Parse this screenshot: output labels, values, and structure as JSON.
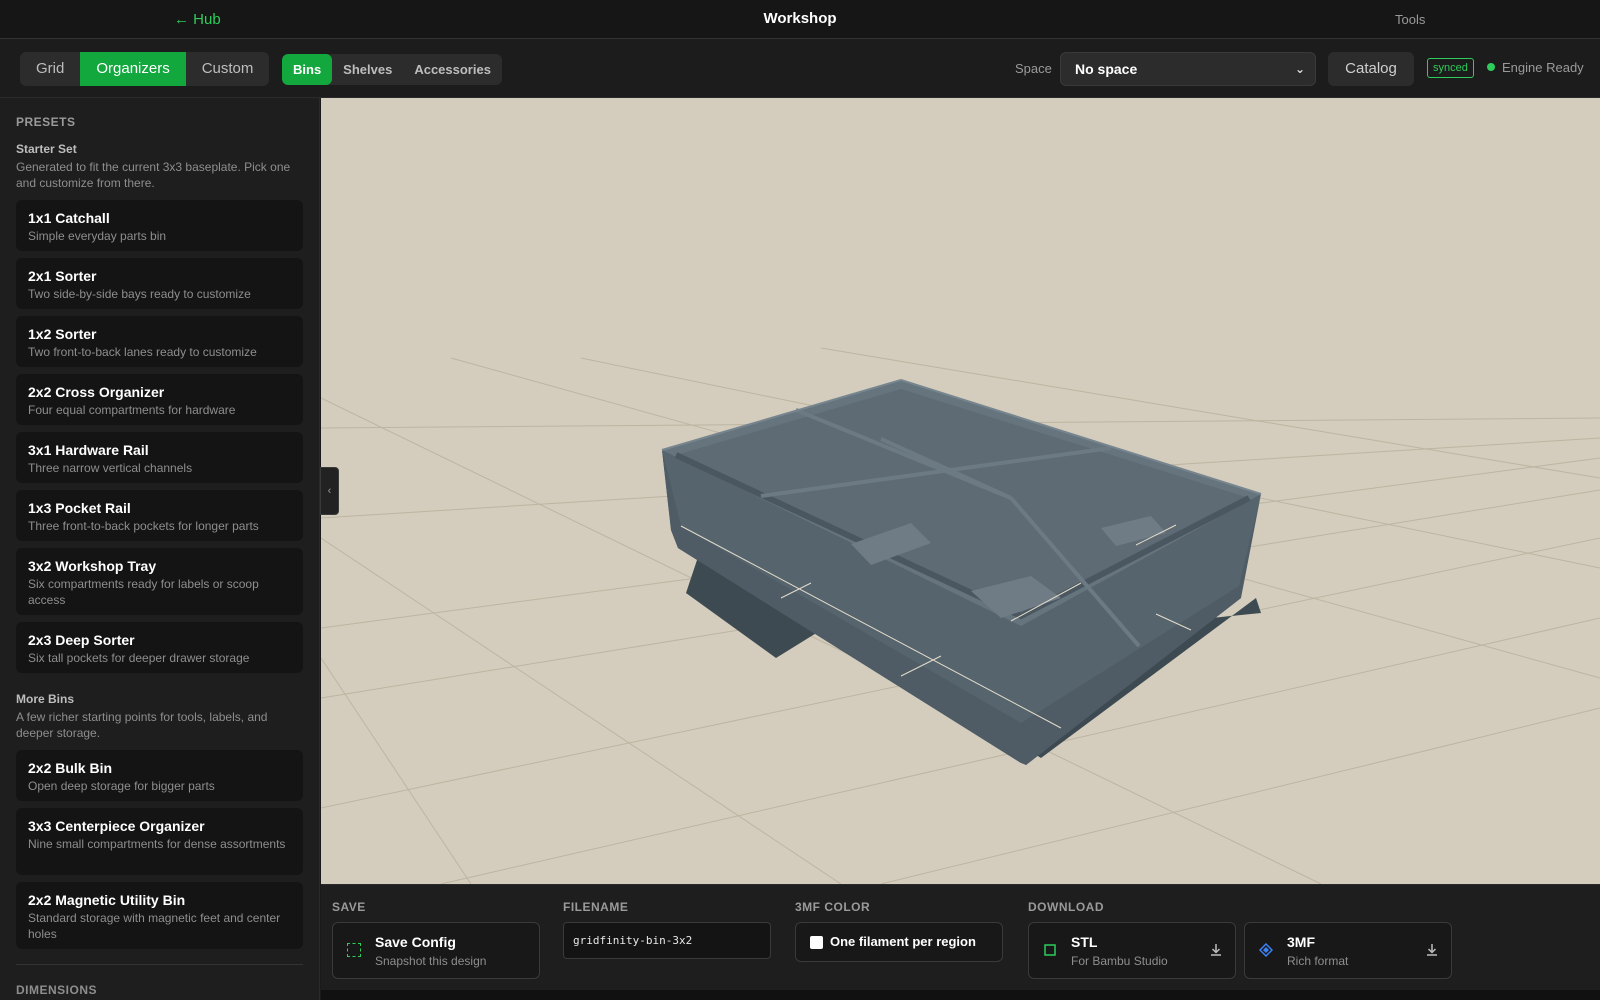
{
  "topbar": {
    "hub": "← Hub",
    "title": "Workshop",
    "tools": "Tools"
  },
  "toolbar": {
    "modes": [
      "Grid",
      "Organizers",
      "Custom"
    ],
    "active_mode": "Organizers",
    "subtabs": [
      "Bins",
      "Shelves",
      "Accessories"
    ],
    "active_subtab": "Bins",
    "space_label": "Space",
    "space_value": "No space",
    "catalog": "Catalog",
    "synced": "synced",
    "engine": "Engine Ready"
  },
  "sidebar": {
    "heading": "PRESETS",
    "groups": [
      {
        "title": "Starter Set",
        "desc": "Generated to fit the current 3x3 baseplate. Pick one and customize from there.",
        "items": [
          {
            "name": "1x1 Catchall",
            "desc": "Simple everyday parts bin"
          },
          {
            "name": "2x1 Sorter",
            "desc": "Two side-by-side bays ready to customize"
          },
          {
            "name": "1x2 Sorter",
            "desc": "Two front-to-back lanes ready to customize"
          },
          {
            "name": "2x2 Cross Organizer",
            "desc": "Four equal compartments for hardware"
          },
          {
            "name": "3x1 Hardware Rail",
            "desc": "Three narrow vertical channels"
          },
          {
            "name": "1x3 Pocket Rail",
            "desc": "Three front-to-back pockets for longer parts"
          },
          {
            "name": "3x2 Workshop Tray",
            "desc": "Six compartments ready for labels or scoop access"
          },
          {
            "name": "2x3 Deep Sorter",
            "desc": "Six tall pockets for deeper drawer storage"
          }
        ]
      },
      {
        "title": "More Bins",
        "desc": "A few richer starting points for tools, labels, and deeper storage.",
        "items": [
          {
            "name": "2x2 Bulk Bin",
            "desc": "Open deep storage for bigger parts"
          },
          {
            "name": "3x3 Centerpiece Organizer",
            "desc": "Nine small compartments for dense assortments"
          },
          {
            "name": "2x2 Magnetic Utility Bin",
            "desc": "Standard storage with magnetic feet and center holes"
          }
        ]
      }
    ],
    "next_section": "DIMENSIONS"
  },
  "bottom": {
    "save_label": "SAVE",
    "save_title": "Save Config",
    "save_sub": "Snapshot this design",
    "filename_label": "FILENAME",
    "filename_value": "gridfinity-bin-3x2",
    "color_label": "3MF COLOR",
    "color_option": "One filament per region",
    "color_checked": false,
    "download_label": "DOWNLOAD",
    "stl_title": "STL",
    "stl_sub": "For Bambu Studio",
    "mf_title": "3MF",
    "mf_sub": "Rich format"
  },
  "colors": {
    "accent": "#12a83e",
    "viewport_bg": "#d4cdbd",
    "model": "#56646e",
    "stl_icon": "#2ecc5a",
    "mf_icon": "#3b82f6"
  }
}
